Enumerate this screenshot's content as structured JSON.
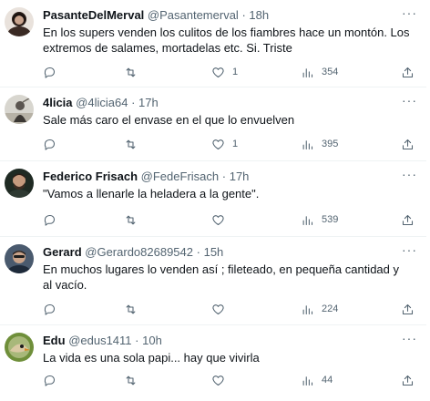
{
  "tweets": [
    {
      "name": "PasanteDelMerval",
      "handle": "@Pasantemerval",
      "sep": "·",
      "time": "18h",
      "text": "En los supers venden los culitos de los fiambres hace un montón. Los extremos de salames, mortadelas etc. Si. Triste",
      "likes": "1",
      "views": "354"
    },
    {
      "name": "4licia",
      "handle": "@4licia64",
      "sep": "·",
      "time": "17h",
      "text": "Sale más caro el envase en el que lo envuelven",
      "likes": "1",
      "views": "395"
    },
    {
      "name": "Federico Frisach",
      "handle": "@FedeFrisach",
      "sep": "·",
      "time": "17h",
      "text": "\"Vamos a llenarle la heladera a la gente\".",
      "likes": "",
      "views": "539"
    },
    {
      "name": "Gerard",
      "handle": "@Gerardo82689542",
      "sep": "·",
      "time": "15h",
      "text": "En muchos lugares lo venden así ; fileteado, en pequeña cantidad y al vacío.",
      "likes": "",
      "views": "224"
    },
    {
      "name": "Edu",
      "handle": "@edus1411",
      "sep": "·",
      "time": "10h",
      "text": "La vida es una sola papi... hay que vivirla",
      "likes": "",
      "views": "44"
    }
  ],
  "more_label": "···",
  "colors": {
    "text": "#0f1419",
    "muted": "#536471",
    "divider": "#eff3f4"
  },
  "icons": [
    "reply-icon",
    "retweet-icon",
    "like-icon",
    "views-icon",
    "share-icon",
    "more-icon"
  ]
}
